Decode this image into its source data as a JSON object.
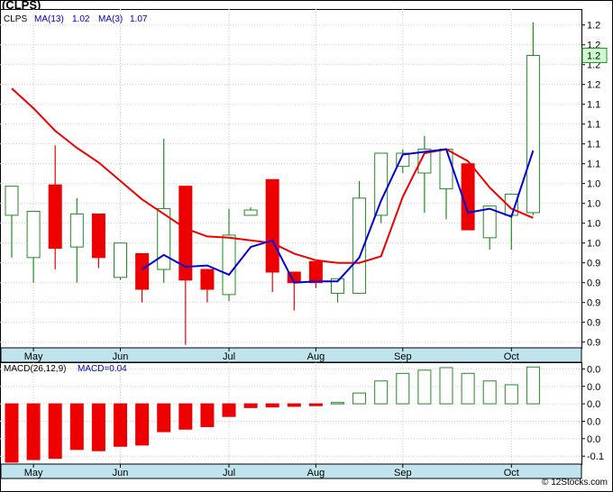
{
  "page": {
    "title": "(CLPS)",
    "watermark": "© 12Stocks.com"
  },
  "colors": {
    "up_candle": "#228B22",
    "down_candle": "#EE0000",
    "ma13": "#EE0000",
    "ma3": "#0000DD",
    "macd_bar_positive": "#228B22",
    "macd_bar_negative": "#EE0000",
    "axis_band": "#bfe4ee",
    "last_price_box": "#ccffcc",
    "grid": "#cccccc"
  },
  "chart_data": [
    {
      "type": "candlestick",
      "title": "(CLPS)",
      "legend": {
        "placement": "top-left",
        "items": [
          "CLPS",
          "MA(13)",
          "1.02",
          "MA(3)",
          "1.07"
        ]
      },
      "x_tick_labels": [
        {
          "label": "May",
          "index": 1
        },
        {
          "label": "Jun",
          "index": 5
        },
        {
          "label": "Jul",
          "index": 10
        },
        {
          "label": "Aug",
          "index": 14
        },
        {
          "label": "Sep",
          "index": 18
        },
        {
          "label": "Oct",
          "index": 23
        }
      ],
      "y_tick_labels": [
        "1.2",
        "1.2",
        "1.2",
        "1.2",
        "1.1",
        "1.1",
        "1.1",
        "1.1",
        "1.0",
        "1.0",
        "1.0",
        "1.0",
        "0.9",
        "0.9",
        "0.9",
        "0.9",
        "0.9"
      ],
      "y_tick_values": [
        1.225,
        1.21,
        1.195,
        1.18,
        1.165,
        1.15,
        1.135,
        1.12,
        1.105,
        1.09,
        1.075,
        1.06,
        1.045,
        1.03,
        1.015,
        1.0,
        0.985
      ],
      "ylim": [
        0.9807,
        1.2371
      ],
      "last_price_label": "1.2",
      "last_price_value": 1.202,
      "candles": [
        {
          "open": 1.081,
          "close": 1.103,
          "high": 1.103,
          "low": 1.049
        },
        {
          "open": 1.049,
          "close": 1.084,
          "high": 1.084,
          "low": 1.03
        },
        {
          "open": 1.104,
          "close": 1.056,
          "high": 1.134,
          "low": 1.04
        },
        {
          "open": 1.057,
          "close": 1.082,
          "high": 1.094,
          "low": 1.03
        },
        {
          "open": 1.082,
          "close": 1.049,
          "high": 1.082,
          "low": 1.041
        },
        {
          "open": 1.034,
          "close": 1.06,
          "high": 1.06,
          "low": 1.032
        },
        {
          "open": 1.052,
          "close": 1.025,
          "high": 1.052,
          "low": 1.015
        },
        {
          "open": 1.04,
          "close": 1.086,
          "high": 1.139,
          "low": 1.03
        },
        {
          "open": 1.103,
          "close": 1.032,
          "high": 1.103,
          "low": 0.983
        },
        {
          "open": 1.04,
          "close": 1.025,
          "high": 1.04,
          "low": 1.015
        },
        {
          "open": 1.021,
          "close": 1.066,
          "high": 1.086,
          "low": 1.016
        },
        {
          "open": 1.081,
          "close": 1.085,
          "high": 1.087,
          "low": 1.081
        },
        {
          "open": 1.108,
          "close": 1.038,
          "high": 1.108,
          "low": 1.023
        },
        {
          "open": 1.038,
          "close": 1.03,
          "high": 1.038,
          "low": 1.009
        },
        {
          "open": 1.046,
          "close": 1.03,
          "high": 1.046,
          "low": 1.026
        },
        {
          "open": 1.022,
          "close": 1.033,
          "high": 1.033,
          "low": 1.015
        },
        {
          "open": 1.022,
          "close": 1.094,
          "high": 1.107,
          "low": 1.022
        },
        {
          "open": 1.081,
          "close": 1.128,
          "high": 1.128,
          "low": 1.075
        },
        {
          "open": 1.118,
          "close": 1.128,
          "high": 1.131,
          "low": 1.113
        },
        {
          "open": 1.113,
          "close": 1.131,
          "high": 1.141,
          "low": 1.083
        },
        {
          "open": 1.101,
          "close": 1.131,
          "high": 1.131,
          "low": 1.078
        },
        {
          "open": 1.12,
          "close": 1.07,
          "high": 1.12,
          "low": 1.07
        },
        {
          "open": 1.064,
          "close": 1.088,
          "high": 1.088,
          "low": 1.055
        },
        {
          "open": 1.081,
          "close": 1.097,
          "high": 1.097,
          "low": 1.055
        },
        {
          "open": 1.083,
          "close": 1.202,
          "high": 1.227,
          "low": 1.081
        }
      ],
      "series": [
        {
          "name": "MA(13)",
          "start": 0,
          "values": [
            1.177,
            1.162,
            1.145,
            1.132,
            1.121,
            1.107,
            1.093,
            1.082,
            1.071,
            1.065,
            1.064,
            1.062,
            1.06,
            1.052,
            1.047,
            1.045,
            1.045,
            1.05,
            1.095,
            1.128,
            1.131,
            1.122,
            1.102,
            1.086,
            1.079
          ]
        },
        {
          "name": "MA(3)",
          "start": 6,
          "values": [
            1.04,
            1.051,
            1.042,
            1.043,
            1.036,
            1.057,
            1.062,
            1.03,
            1.031,
            1.031,
            1.049,
            1.092,
            1.127,
            1.129,
            1.131,
            1.083,
            1.086,
            1.08,
            1.13
          ]
        }
      ]
    },
    {
      "type": "bar",
      "title": "",
      "legend": {
        "placement": "top-left",
        "items": [
          "MACD(26,12,9)",
          "MACD=0.04"
        ]
      },
      "y_tick_labels": [
        "0.0",
        "0.0",
        "0.0",
        "0.0",
        "0.0",
        "-0.1"
      ],
      "y_tick_values": [
        0.055,
        0.0275,
        0.0,
        -0.0275,
        -0.055,
        -0.0825
      ],
      "ylim": [
        -0.095,
        0.0655
      ],
      "values": [
        -0.092,
        -0.088,
        -0.086,
        -0.072,
        -0.074,
        -0.067,
        -0.065,
        -0.044,
        -0.04,
        -0.036,
        -0.02,
        -0.006,
        -0.005,
        -0.004,
        -0.003,
        0.002,
        0.017,
        0.036,
        0.048,
        0.053,
        0.057,
        0.048,
        0.036,
        0.03,
        0.058
      ]
    }
  ]
}
